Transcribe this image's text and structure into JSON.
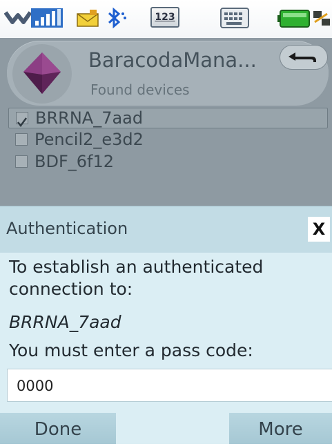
{
  "status_bar": {
    "keypad_mode": "123",
    "icons": [
      "notification-chevron-icon",
      "signal-strength-icon",
      "message-envelope-icon",
      "bluetooth-icon",
      "keypad-123-icon",
      "keyboard-icon",
      "battery-icon",
      "connection-icon"
    ]
  },
  "app": {
    "title": "BaracodaMana...",
    "subtitle": "Found devices",
    "logo_icon": "purple-gem-icon",
    "back_icon": "back-arrow-icon"
  },
  "devices": [
    {
      "label": "BRRNA_7aad",
      "checked": true
    },
    {
      "label": "Pencil2_e3d2",
      "checked": false
    },
    {
      "label": "BDF_6f12",
      "checked": false
    }
  ],
  "dialog": {
    "title": "Authentication",
    "close_label": "X",
    "message": "To establish an authenticated connection to:",
    "device_name": "BRRNA_7aad",
    "prompt": "You must enter a pass code:",
    "passcode_value": "0000"
  },
  "softkeys": {
    "left": "Done",
    "middle": "",
    "right": "More"
  },
  "colors": {
    "dialog_header": "#c2dce5",
    "dialog_body": "#dbeef4",
    "dimmed_background": "#8e9aa2",
    "logo_accent": "#7a2f72"
  }
}
